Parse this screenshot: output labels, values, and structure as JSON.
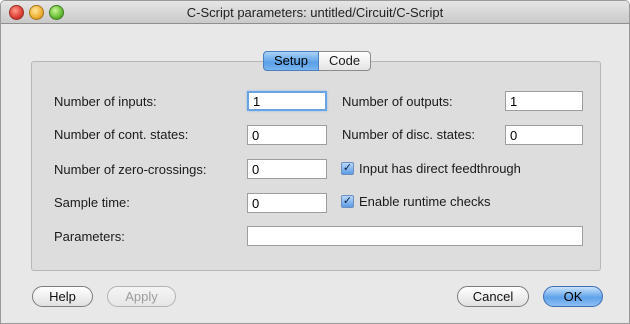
{
  "window": {
    "title": "C-Script parameters: untitled/Circuit/C-Script"
  },
  "tabs": [
    {
      "label": "Setup",
      "active": true
    },
    {
      "label": "Code",
      "active": false
    }
  ],
  "form": {
    "num_inputs_label": "Number of inputs:",
    "num_inputs_value": "1",
    "num_outputs_label": "Number of outputs:",
    "num_outputs_value": "1",
    "num_cont_states_label": "Number of cont. states:",
    "num_cont_states_value": "0",
    "num_disc_states_label": "Number of disc. states:",
    "num_disc_states_value": "0",
    "num_zero_crossings_label": "Number of zero-crossings:",
    "num_zero_crossings_value": "0",
    "direct_feedthrough_label": "Input has direct feedthrough",
    "direct_feedthrough_checked": true,
    "sample_time_label": "Sample time:",
    "sample_time_value": "0",
    "runtime_checks_label": "Enable runtime checks",
    "runtime_checks_checked": true,
    "parameters_label": "Parameters:",
    "parameters_value": ""
  },
  "buttons": {
    "help": "Help",
    "apply": "Apply",
    "cancel": "Cancel",
    "ok": "OK"
  },
  "icons": {
    "close": "close-icon",
    "minimize": "minimize-icon",
    "zoom": "zoom-icon",
    "check": "checkmark-icon"
  },
  "colors": {
    "accent": "#5aa0e8",
    "close": "#e0443a",
    "minimize": "#f1b43a",
    "zoom": "#6dc23a"
  }
}
